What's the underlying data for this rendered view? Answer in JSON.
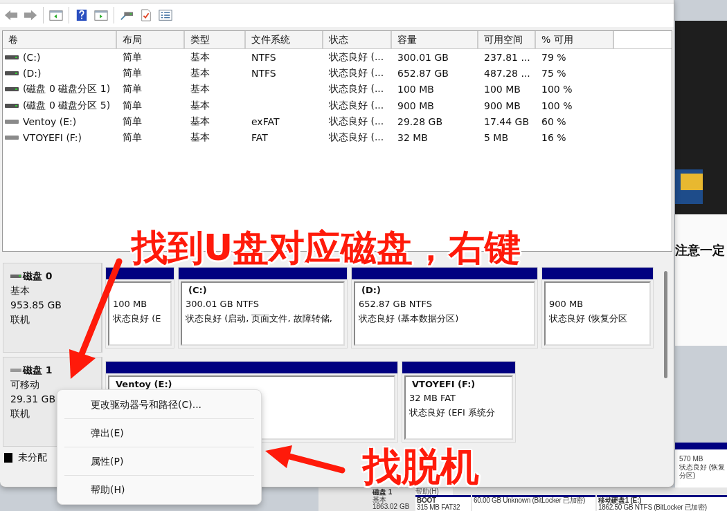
{
  "table": {
    "columns": [
      "卷",
      "布局",
      "类型",
      "文件系统",
      "状态",
      "容量",
      "可用空间",
      "% 可用"
    ],
    "rows": [
      {
        "kind": "fixed",
        "cells": [
          " (C:)",
          "简单",
          "基本",
          "NTFS",
          "状态良好 (...",
          "300.01 GB",
          "237.81 ...",
          "79 %"
        ]
      },
      {
        "kind": "fixed",
        "cells": [
          " (D:)",
          "简单",
          "基本",
          "NTFS",
          "状态良好 (...",
          "652.87 GB",
          "487.28 ...",
          "75 %"
        ]
      },
      {
        "kind": "fixed",
        "cells": [
          "(磁盘 0 磁盘分区 1)",
          "简单",
          "基本",
          "",
          "状态良好 (...",
          "100 MB",
          "100 MB",
          "100 %"
        ]
      },
      {
        "kind": "fixed",
        "cells": [
          "(磁盘 0 磁盘分区 5)",
          "简单",
          "基本",
          "",
          "状态良好 (...",
          "900 MB",
          "900 MB",
          "100 %"
        ]
      },
      {
        "kind": "removable",
        "cells": [
          "Ventoy (E:)",
          "简单",
          "基本",
          "exFAT",
          "状态良好 (...",
          "29.28 GB",
          "17.44 GB",
          "60 %"
        ]
      },
      {
        "kind": "removable",
        "cells": [
          "VTOYEFI (F:)",
          "简单",
          "基本",
          "FAT",
          "状态良好 (...",
          "32 MB",
          "5 MB",
          "16 %"
        ]
      }
    ]
  },
  "disks": [
    {
      "kind": "fixed",
      "name": "磁盘 0",
      "type": "基本",
      "size": "953.85 GB",
      "status": "联机",
      "partitions": [
        {
          "size": "100 MB",
          "status": "状态良好 (E"
        },
        {
          "title": "(C:)",
          "size": "300.01 GB NTFS",
          "status": "状态良好 (启动, 页面文件, 故障转储,"
        },
        {
          "title": "(D:)",
          "size": "652.87 GB NTFS",
          "status": "状态良好 (基本数据分区)"
        },
        {
          "size": "900 MB",
          "status": "状态良好 (恢复分区"
        }
      ]
    },
    {
      "kind": "removable",
      "name": "磁盘 1",
      "type": "可移动",
      "size": "29.31 GB",
      "status": "联机",
      "partitions": [
        {
          "title": "Ventoy  (E:)"
        },
        {
          "title": "VTOYEFI  (F:)",
          "size": "32 MB FAT",
          "status": "状态良好 (EFI 系统分"
        }
      ]
    }
  ],
  "legend": [
    {
      "label": "未分配",
      "color": "#000000"
    }
  ],
  "context_menu": {
    "items": [
      "更改驱动器号和路径(C)...",
      "弹出(E)",
      "属性(P)",
      "帮助(H)"
    ]
  },
  "annotations": [
    "找到U盘对应磁盘，右键",
    "找脱机"
  ],
  "background": {
    "heading": "注意一定",
    "side_size": "570 MB",
    "side_status": "状态良好 (恢复分区)",
    "disk_name": "磁盘 1",
    "disk_type": "基本",
    "disk_size": "1863.02 GB",
    "menu_item": "帮助(H)",
    "partitions": [
      {
        "title": "BOOT",
        "size": "315 MB FAT32"
      },
      {
        "size": "60.00 GB Unknown (BitLocker 已加密)"
      },
      {
        "title": "移动硬盘1 (E:)",
        "size": "1862.50 GB NTFS (BitLocker 已加密)"
      }
    ]
  }
}
